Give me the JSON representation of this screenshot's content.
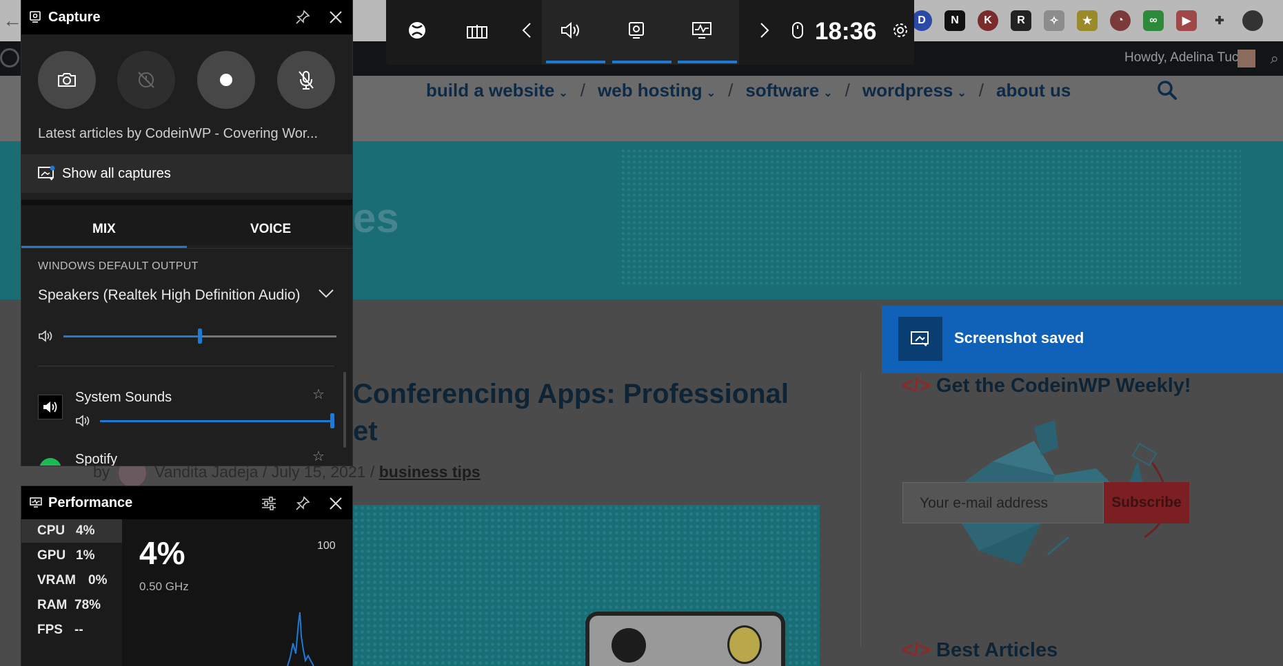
{
  "website": {
    "nav": [
      {
        "label": "build a website"
      },
      {
        "label": "web hosting"
      },
      {
        "label": "software"
      },
      {
        "label": "wordpress"
      },
      {
        "label": "about us"
      }
    ],
    "admin_greeting": "Howdy, Adelina Tuca",
    "hero_title_fragment": "es",
    "article_title_fragment": "Conferencing Apps: Professional\net",
    "meta": {
      "author_prefix": "by",
      "author": "Vandita Jadeja",
      "date": "July 15, 2021",
      "separator": "/",
      "category": "business tips"
    },
    "sidebar": {
      "weekly_tag": "</>",
      "weekly_title": "Get the CodeinWP Weekly!",
      "email_placeholder": "Your e-mail address",
      "subscribe_label": "Subscribe",
      "best_tag": "</>",
      "best_title": "Best Articles"
    }
  },
  "toast": {
    "message": "Screenshot saved"
  },
  "gamebar": {
    "time": "18:36"
  },
  "capture_widget": {
    "title": "Capture",
    "latest_articles": "Latest articles by CodeinWP - Covering Wor...",
    "show_all_label": "Show all captures"
  },
  "audio_widget": {
    "tabs": [
      "MIX",
      "VOICE"
    ],
    "output_label": "WINDOWS DEFAULT OUTPUT",
    "device": "Speakers (Realtek High Definition Audio)",
    "master_volume": 0.5,
    "apps": [
      {
        "name": "System Sounds",
        "volume": 1.0
      },
      {
        "name": "Spotify"
      }
    ]
  },
  "performance_widget": {
    "title": "Performance",
    "metrics": [
      {
        "name": "CPU",
        "value": "4%"
      },
      {
        "name": "GPU",
        "value": "1%"
      },
      {
        "name": "VRAM",
        "value": "0%"
      },
      {
        "name": "RAM",
        "value": "78%"
      },
      {
        "name": "FPS",
        "value": "--"
      }
    ],
    "big_value": "4%",
    "frequency": "0.50 GHz",
    "graph_max": "100"
  },
  "colors": {
    "accent": "#1d7bd8",
    "toast": "#0f62b8",
    "spotify": "#1db954"
  }
}
